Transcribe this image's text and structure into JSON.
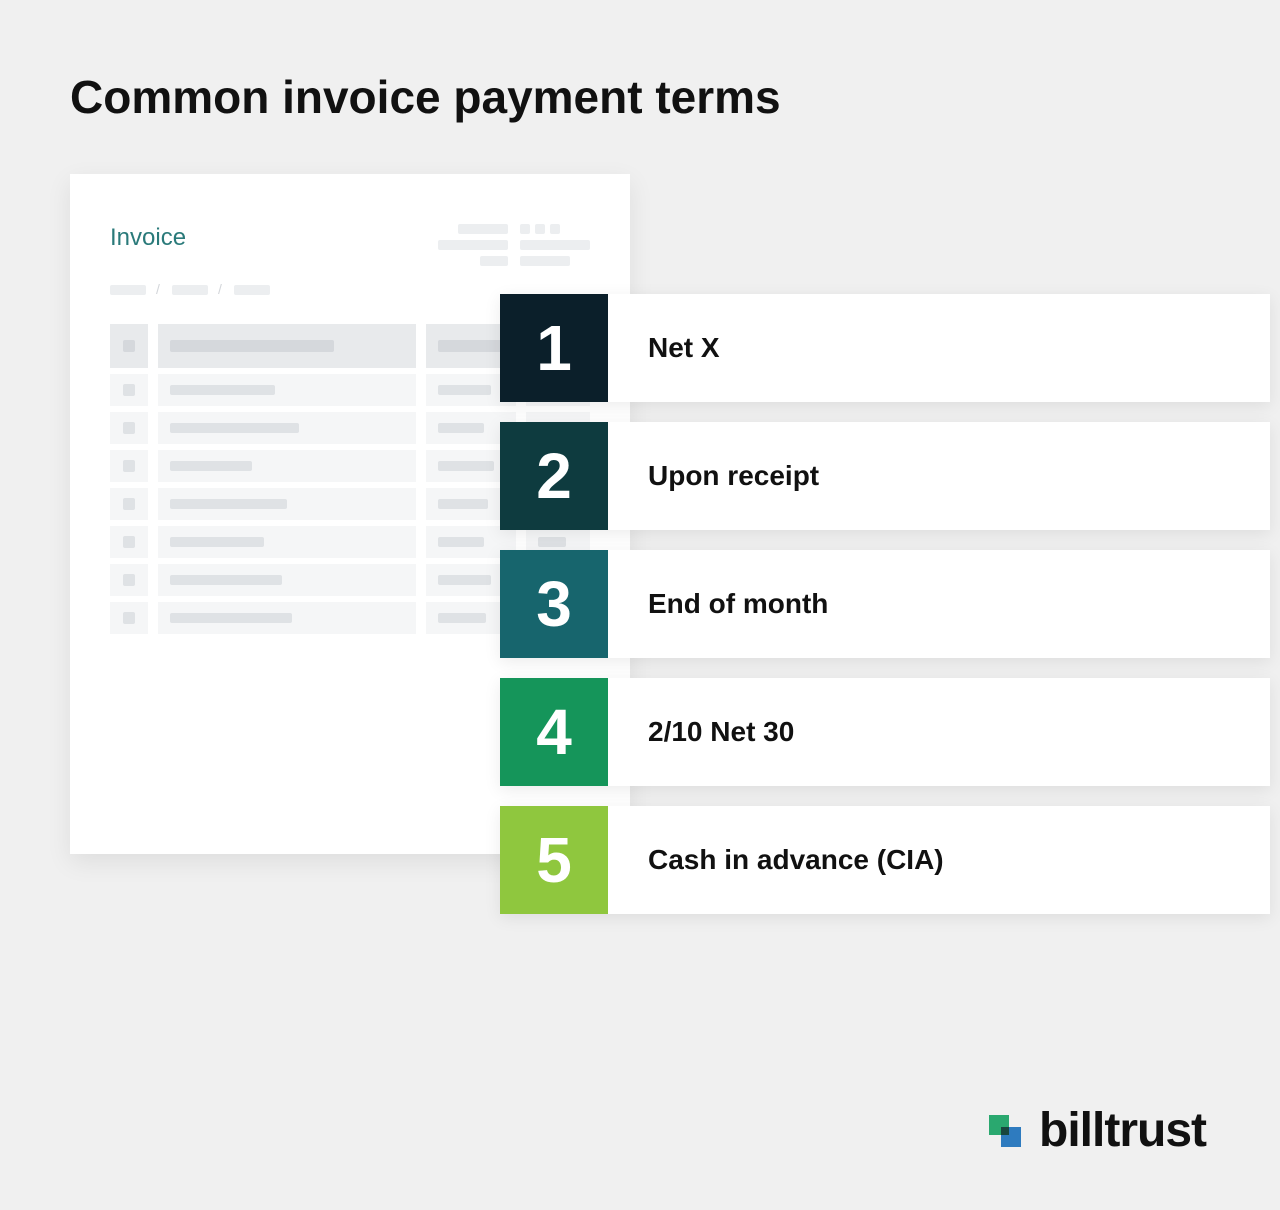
{
  "title": "Common invoice payment terms",
  "invoice": {
    "label": "Invoice"
  },
  "items": [
    {
      "num": "1",
      "label": "Net X",
      "color": "#0b1f2a"
    },
    {
      "num": "2",
      "label": "Upon receipt",
      "color": "#0e3b3f"
    },
    {
      "num": "3",
      "label": "End of month",
      "color": "#17656d"
    },
    {
      "num": "4",
      "label": "2/10 Net 30",
      "color": "#15955a"
    },
    {
      "num": "5",
      "label": "Cash in advance (CIA)",
      "color": "#8fc73e"
    }
  ],
  "brand": {
    "name": "billtrust"
  }
}
